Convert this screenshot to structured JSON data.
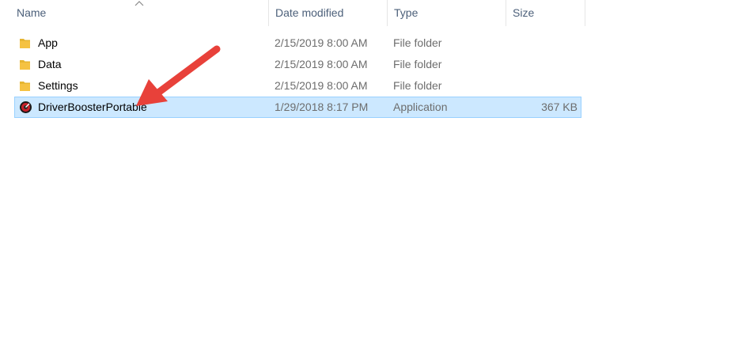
{
  "columns": {
    "name": "Name",
    "date_modified": "Date modified",
    "type": "Type",
    "size": "Size"
  },
  "sort": {
    "column": "name",
    "direction": "ascending",
    "icon": "chevron-up-icon"
  },
  "files": [
    {
      "name": "App",
      "date_modified": "2/15/2019 8:00 AM",
      "type": "File folder",
      "size": "",
      "icon": "folder-icon",
      "selected": false
    },
    {
      "name": "Data",
      "date_modified": "2/15/2019 8:00 AM",
      "type": "File folder",
      "size": "",
      "icon": "folder-icon",
      "selected": false
    },
    {
      "name": "Settings",
      "date_modified": "2/15/2019 8:00 AM",
      "type": "File folder",
      "size": "",
      "icon": "folder-icon",
      "selected": false
    },
    {
      "name": "DriverBoosterPortable",
      "date_modified": "1/29/2018 8:17 PM",
      "type": "Application",
      "size": "367 KB",
      "icon": "driver-booster-app-icon",
      "selected": true
    }
  ],
  "annotation": {
    "icon": "red-arrow-annotation",
    "color": "#e8413a"
  },
  "colors": {
    "header_text": "#4c607a",
    "secondary_text": "#6d6d6d",
    "selection_fill": "#cce8ff",
    "selection_border": "#99d1ff",
    "folder": "#f5c242"
  }
}
